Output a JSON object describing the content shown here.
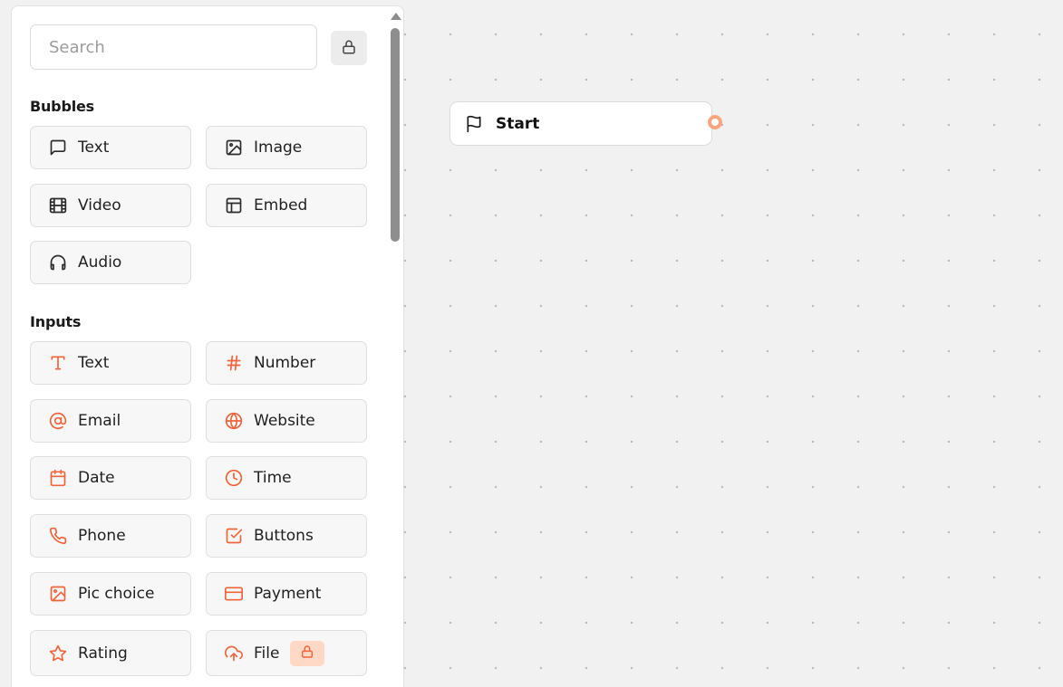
{
  "sidebar": {
    "search": {
      "placeholder": "Search",
      "value": ""
    },
    "lock_icon": "lock-icon",
    "sections": {
      "bubbles": {
        "title": "Bubbles",
        "items": [
          {
            "label": "Text",
            "icon": "chat-bubble-icon"
          },
          {
            "label": "Image",
            "icon": "image-icon"
          },
          {
            "label": "Video",
            "icon": "film-icon"
          },
          {
            "label": "Embed",
            "icon": "layout-icon"
          },
          {
            "label": "Audio",
            "icon": "headphones-icon"
          }
        ]
      },
      "inputs": {
        "title": "Inputs",
        "items": [
          {
            "label": "Text",
            "icon": "type-icon"
          },
          {
            "label": "Number",
            "icon": "hash-icon"
          },
          {
            "label": "Email",
            "icon": "at-sign-icon"
          },
          {
            "label": "Website",
            "icon": "globe-icon"
          },
          {
            "label": "Date",
            "icon": "calendar-icon"
          },
          {
            "label": "Time",
            "icon": "clock-icon"
          },
          {
            "label": "Phone",
            "icon": "phone-icon"
          },
          {
            "label": "Buttons",
            "icon": "check-square-icon"
          },
          {
            "label": "Pic choice",
            "icon": "image-icon"
          },
          {
            "label": "Payment",
            "icon": "credit-card-icon"
          },
          {
            "label": "Rating",
            "icon": "star-icon"
          },
          {
            "label": "File",
            "icon": "upload-cloud-icon",
            "locked": true
          }
        ]
      }
    }
  },
  "canvas": {
    "start_node": {
      "label": "Start",
      "icon": "flag-icon"
    }
  },
  "colors": {
    "accent": "#f0643c",
    "bubble_icon": "#2b2b2b",
    "handle": "#f9a57d",
    "pro_badge_bg": "#ffd9c6"
  }
}
